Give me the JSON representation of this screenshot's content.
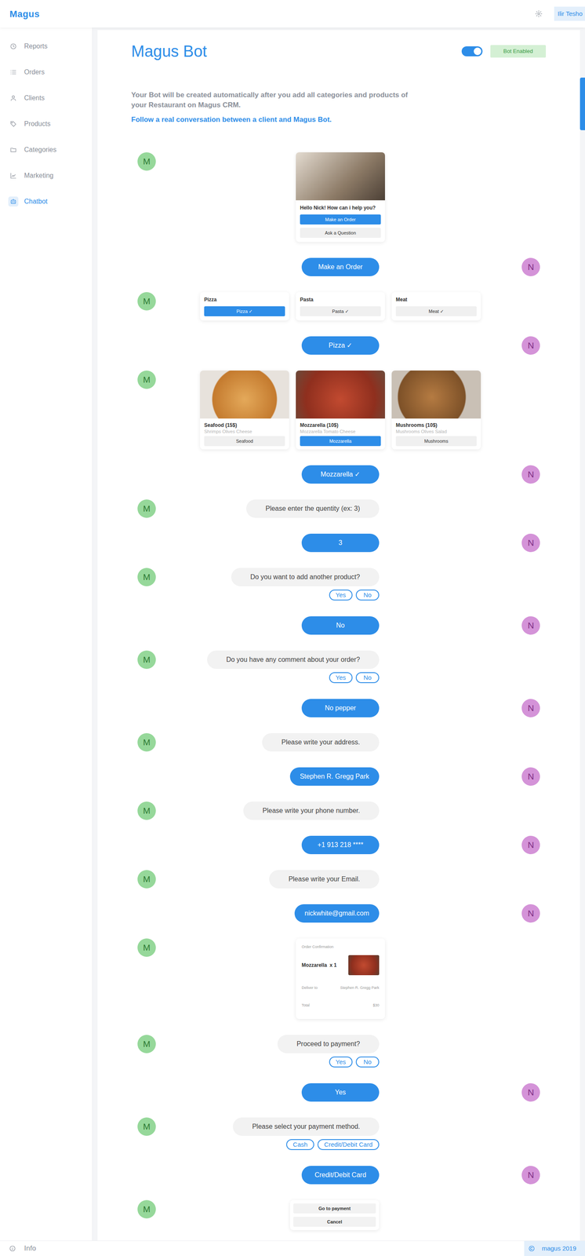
{
  "app": {
    "logo": "Magus",
    "user": "Ilir Tesho"
  },
  "sidebar": {
    "items": [
      {
        "label": "Reports",
        "selected": false
      },
      {
        "label": "Orders",
        "selected": false
      },
      {
        "label": "Clients",
        "selected": false
      },
      {
        "label": "Products",
        "selected": false
      },
      {
        "label": "Categories",
        "selected": false
      },
      {
        "label": "Marketing",
        "selected": false
      },
      {
        "label": "Chatbot",
        "selected": true
      }
    ]
  },
  "header": {
    "title": "Magus Bot",
    "bot_enabled": true,
    "status": "Bot Enabled"
  },
  "intro": {
    "text": "Your Bot will be created automatically after you add all categories and products of your Restaurant on Magus CRM.",
    "link": "Follow a real conversation between a client and Magus Bot."
  },
  "conversation": [
    {
      "kind": "welcome",
      "avatar": "M",
      "text": "Hello Nick! How can i help you?",
      "buttons": [
        {
          "label": "Make an Order",
          "selected": true
        },
        {
          "label": "Ask a Question",
          "selected": false
        }
      ]
    },
    {
      "kind": "reply",
      "avatar": "N",
      "text": "Make an Order"
    },
    {
      "kind": "categories",
      "avatar": "M",
      "items": [
        {
          "title": "Pizza",
          "button": "Pizza ✓",
          "selected": true
        },
        {
          "title": "Pasta",
          "button": "Pasta ✓",
          "selected": false
        },
        {
          "title": "Meat",
          "button": "Meat ✓",
          "selected": false
        }
      ]
    },
    {
      "kind": "reply",
      "avatar": "N",
      "text": "Pizza ✓"
    },
    {
      "kind": "products",
      "avatar": "M",
      "items": [
        {
          "title": "Seafood (15$)",
          "subtitle": "Shrimps Olives Cheese",
          "button": "Seafood",
          "selected": false
        },
        {
          "title": "Mozzarella (10$)",
          "subtitle": "Mozzarella Tomato Cheese",
          "button": "Mozzarella",
          "selected": true
        },
        {
          "title": "Mushrooms (10$)",
          "subtitle": "Mushrooms Olives Salad",
          "button": "Mushrooms",
          "selected": false
        }
      ]
    },
    {
      "kind": "reply",
      "avatar": "N",
      "text": "Mozzarella ✓"
    },
    {
      "kind": "text",
      "avatar": "M",
      "text": "Please enter the quentity (ex: 3)",
      "choices": []
    },
    {
      "kind": "reply",
      "avatar": "N",
      "text": "3"
    },
    {
      "kind": "text",
      "avatar": "M",
      "text": "Do you want to add another product?",
      "choices": [
        "Yes",
        "No"
      ]
    },
    {
      "kind": "reply",
      "avatar": "N",
      "text": "No"
    },
    {
      "kind": "text",
      "avatar": "M",
      "text": "Do you have any comment about your order?",
      "choices": [
        "Yes",
        "No"
      ]
    },
    {
      "kind": "reply",
      "avatar": "N",
      "text": "No pepper"
    },
    {
      "kind": "text",
      "avatar": "M",
      "text": "Please write your address.",
      "choices": []
    },
    {
      "kind": "reply",
      "avatar": "N",
      "text": "Stephen R. Gregg Park"
    },
    {
      "kind": "text",
      "avatar": "M",
      "text": "Please write your phone number.",
      "choices": []
    },
    {
      "kind": "reply",
      "avatar": "N",
      "text": "+1 913 218 ****"
    },
    {
      "kind": "text",
      "avatar": "M",
      "text": "Please write your Email.",
      "choices": []
    },
    {
      "kind": "reply",
      "avatar": "N",
      "text": "nickwhite@gmail.com"
    },
    {
      "kind": "order",
      "avatar": "M",
      "heading": "Order Confirmation",
      "item": "Mozzarella  x 1",
      "deliver_label": "Deliver to",
      "address": "Stephen R. Gregg Park",
      "total_label": "Total",
      "total": "$30"
    },
    {
      "kind": "text",
      "avatar": "M",
      "text": "Proceed to payment?",
      "choices": [
        "Yes",
        "No"
      ]
    },
    {
      "kind": "reply",
      "avatar": "N",
      "text": "Yes"
    },
    {
      "kind": "text",
      "avatar": "M",
      "text": "Please select your payment method.",
      "choices": [
        "Cash",
        "Credit/Debit Card"
      ]
    },
    {
      "kind": "reply",
      "avatar": "N",
      "text": "Credit/Debit Card"
    },
    {
      "kind": "actions",
      "avatar": "M",
      "buttons": [
        "Go to payment",
        "Cancel"
      ]
    }
  ],
  "footer": {
    "info": "Info",
    "copyright": "magus 2019"
  }
}
